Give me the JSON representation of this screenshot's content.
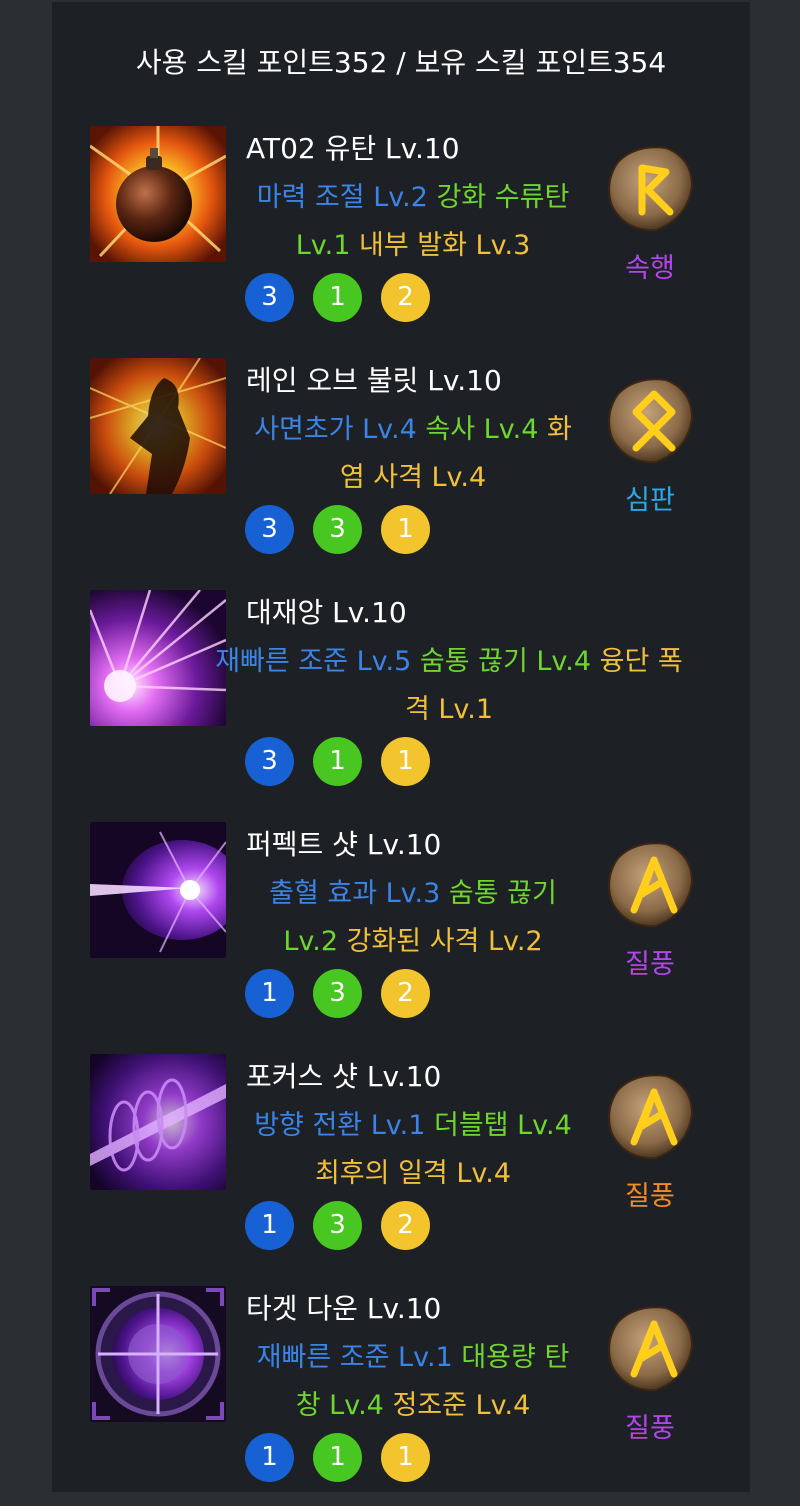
{
  "header": {
    "title": "사용 스킬 포인트352 / 보유 스킬 포인트354"
  },
  "colors": {
    "tripod_blue": "#3b84e6",
    "tripod_green": "#6fd62d",
    "tripod_yellow": "#f0c03a",
    "circle_blue": "#1861d4",
    "circle_green": "#48c622",
    "circle_yellow": "#f2c42e",
    "rune_purple": "#b346ea",
    "rune_cyan": "#29a9e8",
    "rune_orange": "#f18b2a"
  },
  "skills": [
    {
      "name": "AT02 유탄 Lv.10",
      "icon": "grenade-skill-icon",
      "tripods": [
        {
          "text": "마력 조절 Lv.2",
          "color": "blue"
        },
        {
          "text": "강화 수류탄 Lv.1",
          "color": "green"
        },
        {
          "text": "내부 발화 Lv.3",
          "color": "yellow"
        }
      ],
      "levels": [
        "3",
        "1",
        "2"
      ],
      "rune": {
        "name": "속행",
        "icon": "rune-haste-icon",
        "color": "#b346ea"
      }
    },
    {
      "name": "레인 오브 불릿 Lv.10",
      "icon": "rain-of-bullets-skill-icon",
      "tripods": [
        {
          "text": "사면초가 Lv.4",
          "color": "blue"
        },
        {
          "text": "속사 Lv.4",
          "color": "green"
        },
        {
          "text": "화염 사격 Lv.4",
          "color": "yellow"
        }
      ],
      "levels": [
        "3",
        "3",
        "1"
      ],
      "rune": {
        "name": "심판",
        "icon": "rune-judgment-icon",
        "color": "#29a9e8"
      }
    },
    {
      "name": "대재앙 Lv.10",
      "icon": "catastrophe-skill-icon",
      "tripods": [
        {
          "text": "재빠른 조준 Lv.5",
          "color": "blue"
        },
        {
          "text": "숨통 끊기 Lv.4",
          "color": "green"
        },
        {
          "text": "융단 폭격 Lv.1",
          "color": "yellow"
        }
      ],
      "levels": [
        "3",
        "1",
        "1"
      ],
      "rune": null
    },
    {
      "name": "퍼펙트 샷 Lv.10",
      "icon": "perfect-shot-skill-icon",
      "tripods": [
        {
          "text": "출혈 효과 Lv.3",
          "color": "blue"
        },
        {
          "text": "숨통 끊기 Lv.2",
          "color": "green"
        },
        {
          "text": "강화된 사격 Lv.2",
          "color": "yellow"
        }
      ],
      "levels": [
        "1",
        "3",
        "2"
      ],
      "rune": {
        "name": "질풍",
        "icon": "rune-gale-icon",
        "color": "#b346ea"
      }
    },
    {
      "name": "포커스 샷 Lv.10",
      "icon": "focus-shot-skill-icon",
      "tripods": [
        {
          "text": "방향 전환 Lv.1",
          "color": "blue"
        },
        {
          "text": "더블탭 Lv.4",
          "color": "green"
        },
        {
          "text": "최후의 일격 Lv.4",
          "color": "yellow"
        }
      ],
      "levels": [
        "1",
        "3",
        "2"
      ],
      "rune": {
        "name": "질풍",
        "icon": "rune-gale-icon",
        "color": "#f18b2a"
      }
    },
    {
      "name": "타겟 다운 Lv.10",
      "icon": "target-down-skill-icon",
      "tripods": [
        {
          "text": "재빠른 조준 Lv.1",
          "color": "blue"
        },
        {
          "text": "대용량 탄창 Lv.4",
          "color": "green"
        },
        {
          "text": "정조준 Lv.4",
          "color": "yellow"
        }
      ],
      "levels": [
        "1",
        "1",
        "1"
      ],
      "rune": {
        "name": "질풍",
        "icon": "rune-gale-icon",
        "color": "#b346ea"
      }
    }
  ]
}
